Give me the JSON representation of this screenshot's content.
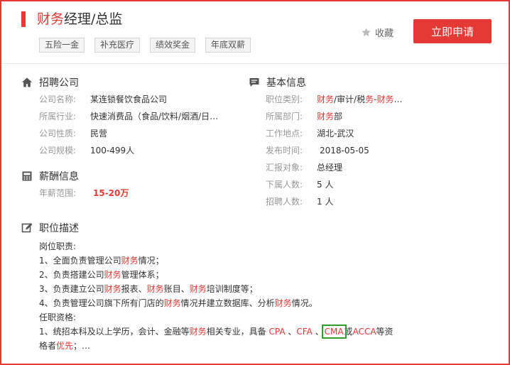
{
  "header": {
    "title_highlight": "财务",
    "title_rest": "经理/总监",
    "tags": [
      "五险一金",
      "补充医疗",
      "绩效奖金",
      "年底双薪"
    ],
    "favorite_label": "收藏",
    "apply_label": "立即申请"
  },
  "company": {
    "heading": "招聘公司",
    "rows": [
      {
        "label": "公司名称:",
        "value": "某连锁餐饮食品公司"
      },
      {
        "label": "所属行业:",
        "value": "快速消费品（食品/饮料/烟酒/日…"
      },
      {
        "label": "公司性质:",
        "value": "民营"
      },
      {
        "label": "公司规模:",
        "value": "100-499人"
      }
    ]
  },
  "salary": {
    "heading": "薪酬信息",
    "label": "年薪范围:",
    "value": "15-20万"
  },
  "basic": {
    "heading": "基本信息",
    "category_label": "职位类别:",
    "category_parts": [
      {
        "text": "财务",
        "hl": true
      },
      {
        "text": "/审计/税",
        "hl": false
      },
      {
        "text": "务-财务",
        "hl": true
      },
      {
        "text": "…",
        "hl": false
      }
    ],
    "department_label": "所属部门:",
    "department_hl": "财务",
    "department_rest": "部",
    "location_label": "工作地点:",
    "location": "湖北-武汉",
    "date_label": "发布时间:",
    "date": "2018-05-05",
    "report_label": "汇报对象:",
    "report": "总经理",
    "subordinates_label": "下属人数:",
    "subordinates": "5 人",
    "hires_label": "招聘人数:",
    "hires": "1 人"
  },
  "description": {
    "heading": "职位描述",
    "lines": [
      [
        {
          "t": "岗位职责:"
        }
      ],
      [
        {
          "t": "1、全面负责管理公司"
        },
        {
          "t": "财务",
          "hl": true
        },
        {
          "t": "情况；"
        }
      ],
      [
        {
          "t": "2、负责搭建公司"
        },
        {
          "t": "财务",
          "hl": true
        },
        {
          "t": "管理体系；"
        }
      ],
      [
        {
          "t": "3、负责建立公司"
        },
        {
          "t": "财务",
          "hl": true
        },
        {
          "t": "报表、"
        },
        {
          "t": "财务",
          "hl": true
        },
        {
          "t": "账目、"
        },
        {
          "t": "财务",
          "hl": true
        },
        {
          "t": "培训制度等；"
        }
      ],
      [
        {
          "t": "4、负责管理公司旗下所有门店的"
        },
        {
          "t": "财务",
          "hl": true
        },
        {
          "t": "情况并建立数据库、分析"
        },
        {
          "t": "财务",
          "hl": true
        },
        {
          "t": "情况。"
        }
      ],
      [
        {
          "t": "任职资格:"
        }
      ],
      [
        {
          "t": "1、统招本科及以上学历，会计、金融等"
        },
        {
          "t": "财务",
          "hl": true
        },
        {
          "t": "相关专业，具备 "
        },
        {
          "t": "CPA",
          "hl": true
        },
        {
          "t": " 、"
        },
        {
          "t": "CFA",
          "hl": true
        },
        {
          "t": " 、"
        },
        {
          "t": "CMA",
          "hl": true,
          "boxed": true
        },
        {
          "t": "或"
        },
        {
          "t": "ACCA",
          "hl": true
        },
        {
          "t": "等资"
        }
      ],
      [
        {
          "t": "格者"
        },
        {
          "t": "优先",
          "hl": true
        },
        {
          "t": "；…"
        }
      ]
    ]
  },
  "colors": {
    "accent": "#e53935",
    "highlight_box": "#2ea02e"
  }
}
